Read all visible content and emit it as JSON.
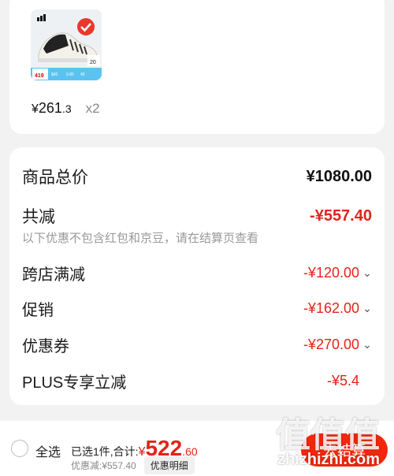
{
  "product": {
    "image_icon": "sneaker-product-image",
    "badge_icon": "check-badge-icon",
    "thumb_labels": [
      "419",
      "20",
      "$40",
      "0.85",
      "40"
    ],
    "price_currency": "¥",
    "price_int": "261",
    "price_dec": ".3",
    "quantity": "x2"
  },
  "summary": {
    "total_label": "商品总价",
    "total_value": "¥1080.00",
    "reduce_label": "共减",
    "reduce_value": "-¥557.40",
    "note": "以下优惠不包含红包和京豆，请在结算页查看",
    "items": [
      {
        "label": "跨店满减",
        "value": "-¥120.00"
      },
      {
        "label": "促销",
        "value": "-¥162.00"
      },
      {
        "label": "优惠券",
        "value": "-¥270.00"
      },
      {
        "label": "PLUS专享立减",
        "value": "-¥5.4"
      }
    ]
  },
  "bottom": {
    "select_all": "全选",
    "selected_text": "已选1件,合计:",
    "total_currency": "¥",
    "total_int": "522",
    "total_dec": ".60",
    "discount_text": "优惠减:¥557.40",
    "detail_button": "优惠明细",
    "checkout_button": "去结算"
  },
  "watermark": {
    "main": "值值值",
    "sub": "zhizhizhi.com"
  },
  "colors": {
    "accent_red": "#e2231a",
    "checkout_red": "#f2270c"
  }
}
